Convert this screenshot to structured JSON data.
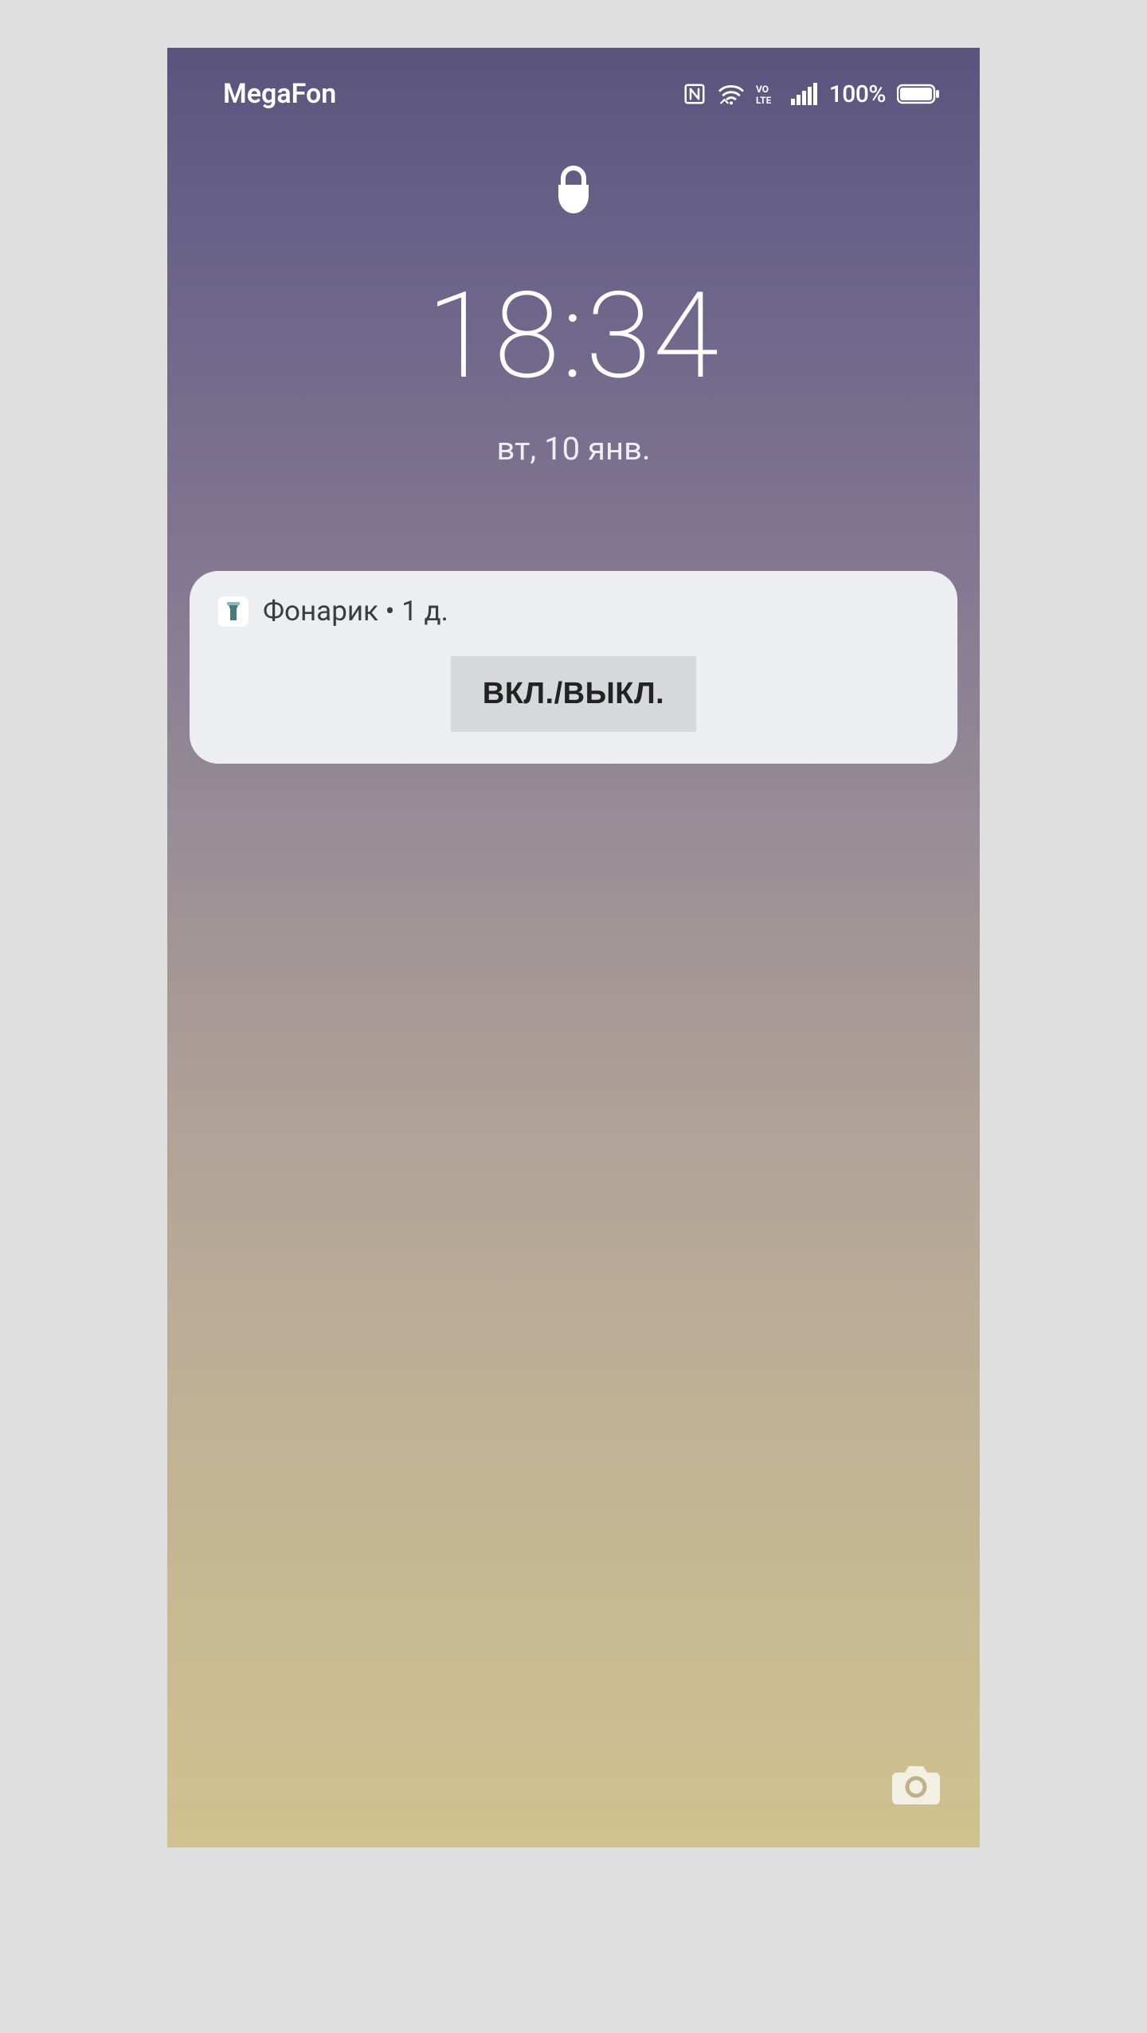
{
  "status": {
    "carrier": "MegaFon",
    "battery_percent": "100%",
    "volte_label": "VoLTE"
  },
  "lockscreen": {
    "time": "18:34",
    "date": "вт, 10 янв."
  },
  "notification": {
    "app_name": "Фонарик",
    "age": "1 д.",
    "separator": " • ",
    "button_label": "ВКЛ./ВЫКЛ."
  }
}
